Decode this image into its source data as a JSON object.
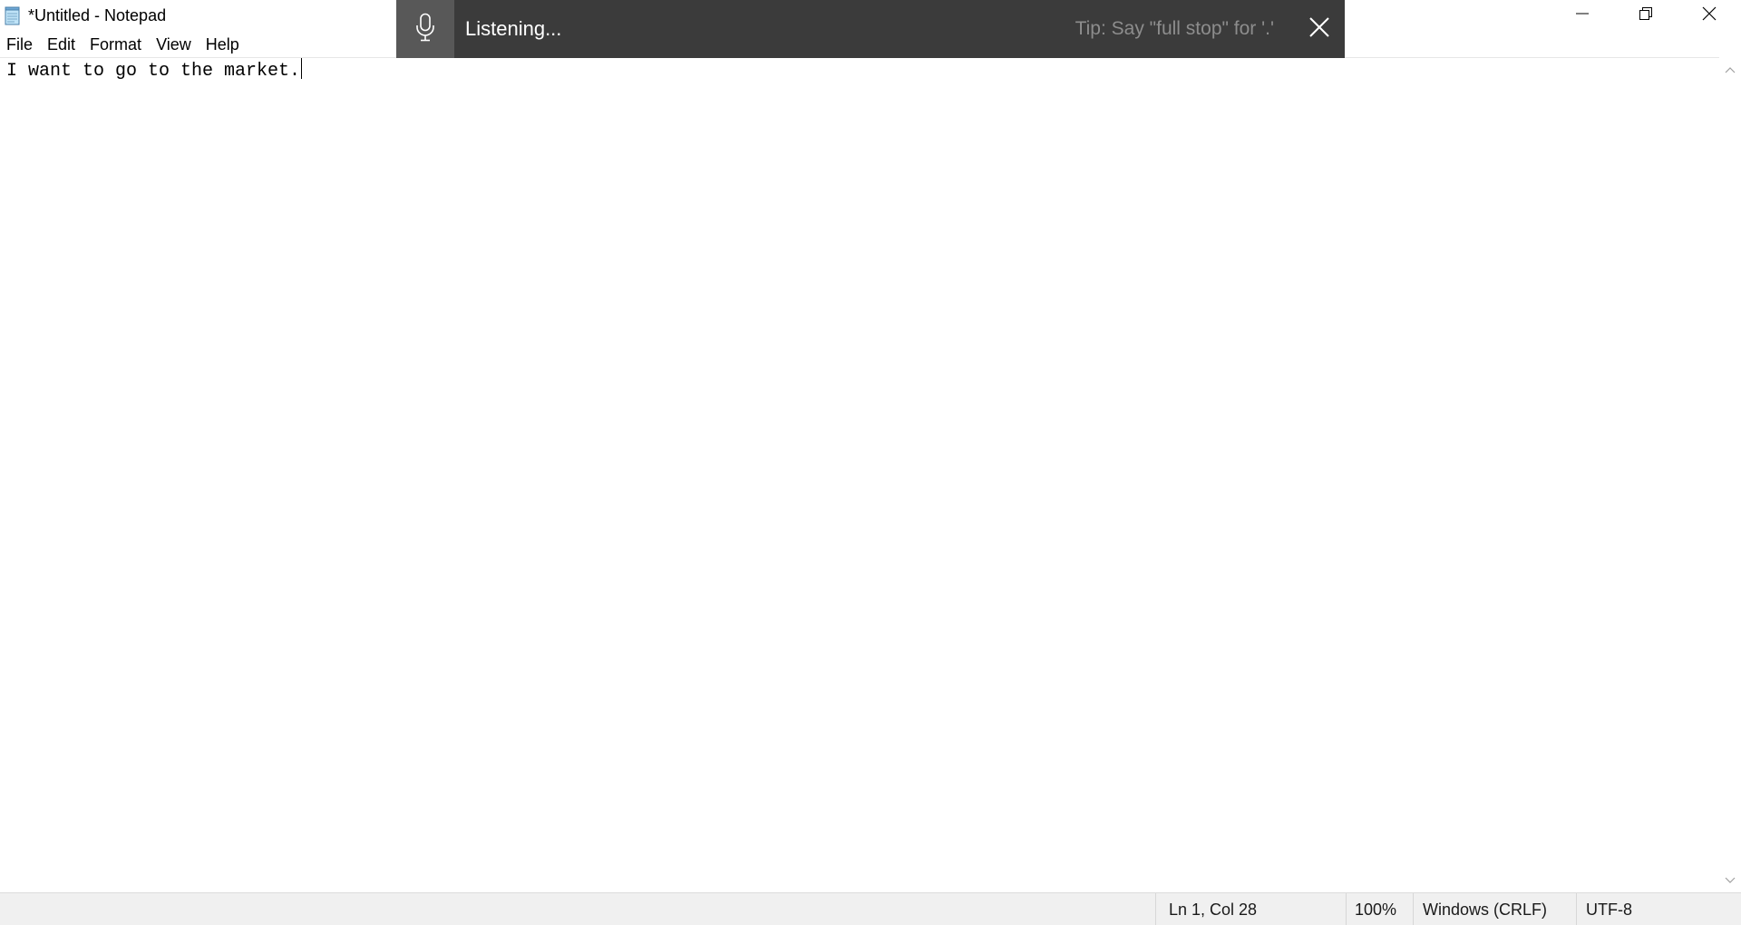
{
  "window": {
    "title": "*Untitled - Notepad",
    "icon": "notepad-icon"
  },
  "menu": {
    "items": [
      "File",
      "Edit",
      "Format",
      "View",
      "Help"
    ]
  },
  "dictation": {
    "status": "Listening...",
    "tip": "Tip: Say \"full stop\" for '.'",
    "mic_icon": "microphone-icon",
    "close_icon": "close-icon",
    "background": "#3b3b3b"
  },
  "editor": {
    "content": "I want to go to the market."
  },
  "statusbar": {
    "position": "Ln 1, Col 28",
    "zoom": "100%",
    "line_ending": "Windows (CRLF)",
    "encoding": "UTF-8"
  }
}
